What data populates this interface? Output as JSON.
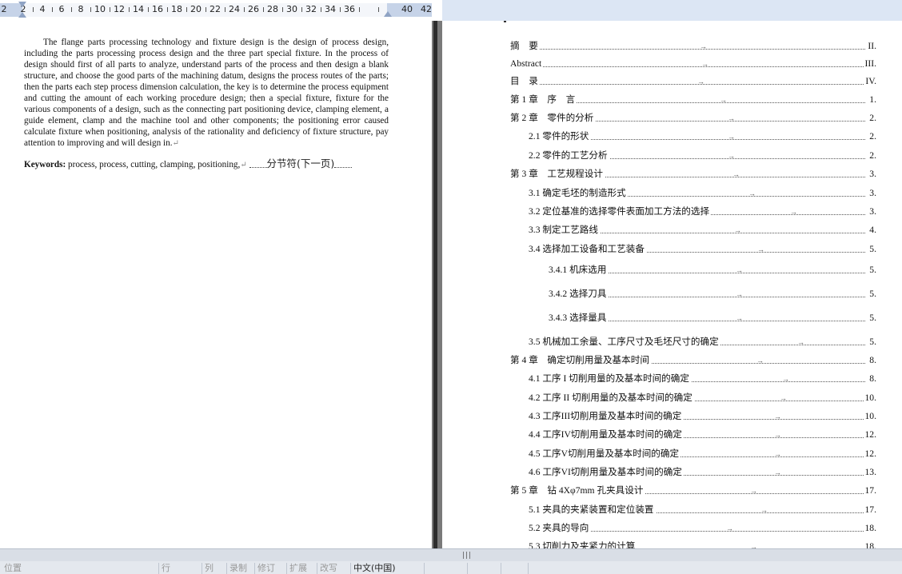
{
  "ruler": {
    "labels": [
      "2",
      "2",
      "4",
      "6",
      "8",
      "10",
      "12",
      "14",
      "16",
      "18",
      "20",
      "22",
      "24",
      "26",
      "28",
      "30",
      "32",
      "34",
      "36",
      "40",
      "42"
    ]
  },
  "left_page": {
    "abstract": "The flange parts processing technology and fixture design is the design of process design, including the parts processing process design and the three part special fixture. In the process of design should first of all parts to analyze, understand parts of the process and then design a blank structure, and choose the good parts of the machining datum, designs the process routes of the parts; then the parts each step process dimension calculation, the key is to determine the process equipment and cutting the amount of each working procedure design; then a special fixture, fixture for the various components of a design, such as the connecting part positioning device, clamping element, a guide element, clamp and the machine tool and other components; the positioning error caused calculate fixture when positioning, analysis of the rationality and deficiency of fixture structure, pay attention to improving and will design in.",
    "return_mark": "↵",
    "keywords_label": "Keywords:",
    "keywords_text": " process, process, cutting, clamping, positioning,",
    "section_break": "分节符(下一页)"
  },
  "toc": [
    {
      "title": "摘　要",
      "page": "II"
    },
    {
      "title": "Abstract",
      "page": "III"
    },
    {
      "title": "目　录",
      "page": "IV"
    },
    {
      "title": "第 1 章　序　言",
      "page": "1"
    },
    {
      "title": "第 2 章　零件的分析",
      "page": "2"
    },
    {
      "title": "2.1 零件的形状",
      "page": "2"
    },
    {
      "title": "2.2 零件的工艺分析",
      "page": "2"
    },
    {
      "title": "第 3 章　工艺规程设计",
      "page": "3"
    },
    {
      "title": "3.1  确定毛坯的制造形式",
      "page": "3"
    },
    {
      "title": "3.2 定位基准的选择零件表面加工方法的选择",
      "page": "3"
    },
    {
      "title": "3.3  制定工艺路线",
      "page": "4"
    },
    {
      "title": "3.4  选择加工设备和工艺装备",
      "page": "5"
    },
    {
      "title": "3.4.1  机床选用",
      "page": "5"
    },
    {
      "title": "3.4.2  选择刀具",
      "page": "5"
    },
    {
      "title": "3.4.3  选择量具",
      "page": "5"
    },
    {
      "title": "3.5  机械加工余量、工序尺寸及毛坯尺寸的确定",
      "page": "5"
    },
    {
      "title": "第 4 章　确定切削用量及基本时间",
      "page": "8"
    },
    {
      "title": "4.1  工序 I 切削用量的及基本时间的确定",
      "page": "8"
    },
    {
      "title": "4.2  工序 II 切削用量的及基本时间的确定",
      "page": "10"
    },
    {
      "title": "4.3  工序III切削用量及基本时间的确定",
      "page": "10"
    },
    {
      "title": "4.4  工序IV切削用量及基本时间的确定",
      "page": "12"
    },
    {
      "title": "4.5  工序V切削用量及基本时间的确定",
      "page": "12"
    },
    {
      "title": "4.6  工序VI切削用量及基本时间的确定",
      "page": "13"
    },
    {
      "title": "第 5 章　钻 4Xφ7mm 孔夹具设计",
      "page": "17"
    },
    {
      "title": "5.1  夹具的夹紧装置和定位装置",
      "page": "17"
    },
    {
      "title": "5.2  夹具的导向",
      "page": "18"
    },
    {
      "title": "5.3  切削力及夹紧力的计算",
      "page": "18"
    }
  ],
  "status_bar": {
    "items": [
      "位置",
      "行",
      "列",
      "录制",
      "修订",
      "扩展",
      "改写",
      "中文(中国)"
    ]
  }
}
